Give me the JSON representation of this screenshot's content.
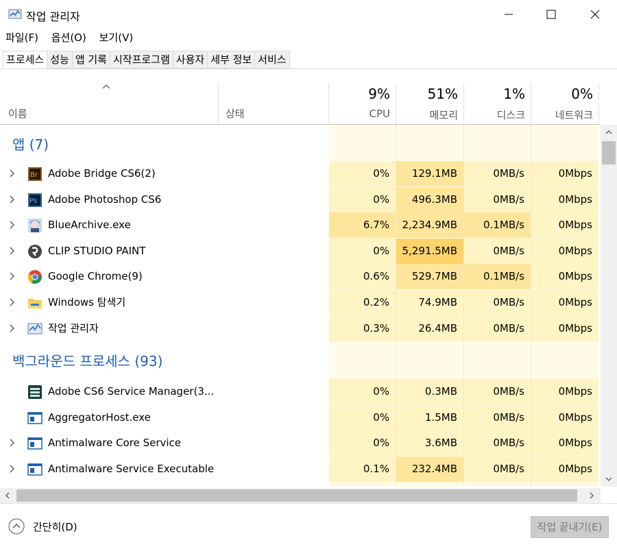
{
  "window": {
    "title": "작업 관리자",
    "controls": [
      "minimize",
      "maximize",
      "close"
    ]
  },
  "menu": [
    "파일(F)",
    "옵션(O)",
    "보기(V)"
  ],
  "tabs": [
    "프로세스",
    "성능",
    "앱 기록",
    "시작프로그램",
    "사용자",
    "세부 정보",
    "서비스"
  ],
  "active_tab": "프로세스",
  "columns": {
    "name": "이름",
    "status": "상태",
    "cpu": {
      "pct": "9%",
      "label": "CPU"
    },
    "memory": {
      "pct": "51%",
      "label": "메모리"
    },
    "disk": {
      "pct": "1%",
      "label": "디스크"
    },
    "network": {
      "pct": "0%",
      "label": "네트워크"
    }
  },
  "groups": {
    "apps": {
      "title": "앱 (7)"
    },
    "background": {
      "title": "백그라운드 프로세스 (93)"
    }
  },
  "apps": [
    {
      "name": "Adobe Bridge CS6(2)",
      "icon": "adobe-bridge-icon",
      "cpu": "0%",
      "mem": "129.1MB",
      "disk": "0MB/s",
      "net": "0Mbps"
    },
    {
      "name": "Adobe Photoshop CS6",
      "icon": "photoshop-icon",
      "cpu": "0%",
      "mem": "496.3MB",
      "disk": "0MB/s",
      "net": "0Mbps"
    },
    {
      "name": "BlueArchive.exe",
      "icon": "bluearchive-icon",
      "cpu": "6.7%",
      "mem": "2,234.9MB",
      "disk": "0.1MB/s",
      "net": "0Mbps"
    },
    {
      "name": "CLIP STUDIO PAINT",
      "icon": "clip-studio-icon",
      "cpu": "0%",
      "mem": "5,291.5MB",
      "disk": "0MB/s",
      "net": "0Mbps"
    },
    {
      "name": "Google Chrome(9)",
      "icon": "chrome-icon",
      "cpu": "0.6%",
      "mem": "529.7MB",
      "disk": "0.1MB/s",
      "net": "0Mbps"
    },
    {
      "name": "Windows 탐색기",
      "icon": "folder-icon",
      "cpu": "0.2%",
      "mem": "74.9MB",
      "disk": "0MB/s",
      "net": "0Mbps"
    },
    {
      "name": "작업 관리자",
      "icon": "task-manager-icon",
      "cpu": "0.3%",
      "mem": "26.4MB",
      "disk": "0MB/s",
      "net": "0Mbps"
    }
  ],
  "background": [
    {
      "name": "Adobe CS6 Service Manager(3...",
      "icon": "service-manager-icon",
      "cpu": "0%",
      "mem": "0.3MB",
      "disk": "0MB/s",
      "net": "0Mbps"
    },
    {
      "name": "AggregatorHost.exe",
      "icon": "window-app-icon",
      "cpu": "0%",
      "mem": "1.5MB",
      "disk": "0MB/s",
      "net": "0Mbps"
    },
    {
      "name": "Antimalware Core Service",
      "icon": "window-app-icon",
      "cpu": "0%",
      "mem": "3.6MB",
      "disk": "0MB/s",
      "net": "0Mbps"
    },
    {
      "name": "Antimalware Service Executable",
      "icon": "window-app-icon",
      "cpu": "0.1%",
      "mem": "232.4MB",
      "disk": "0MB/s",
      "net": "0Mbps"
    }
  ],
  "footer": {
    "collapse": "간단히(D)",
    "end_task": "작업 끝내기(E)"
  },
  "colors": {
    "heat_light": "#fff4c4",
    "heat_mid": "#fde69c",
    "heat_strong": "#fcd26a",
    "header_bg_light": "#fffbe6",
    "group_title": "#1a5fb4"
  }
}
